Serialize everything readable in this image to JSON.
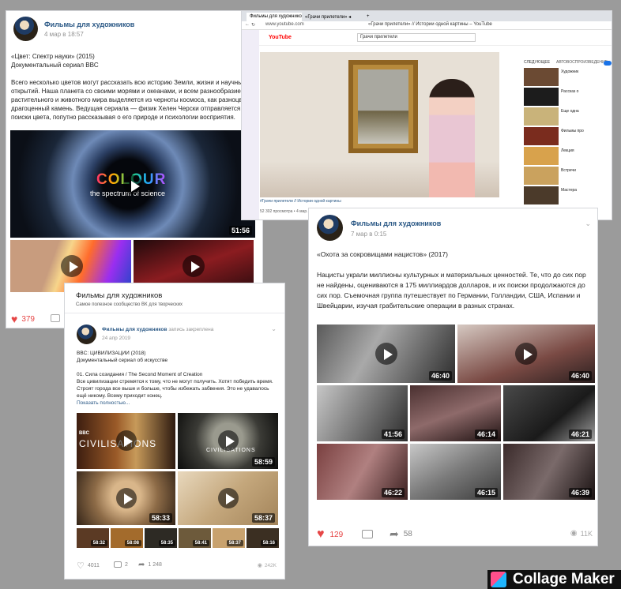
{
  "post1": {
    "group": "Фильмы для художников",
    "date": "4 мар в 18:57",
    "title_line1": "«Цвет: Спектр науки» (2015)",
    "title_line2": "Документальный сериал BBC",
    "body": "Всего несколько цветов могут рассказать всю историю Земли, жизни и научных открытий. Наша планета со своими морями и океанами, и всем разнообразием растительного и животного мира выделяется из черноты космоса, как разноцветный драгоценный камень. Ведущая сериала — физик Хелен Черски отправляется на поиски цвета, попутно рассказывая о его природе и психологии восприятия.",
    "video_title_main": "COLOUR",
    "video_title_sub": "the spectrum of science",
    "video_duration": "51:56",
    "likes": "379"
  },
  "browser": {
    "tab1": "Фильмы для художников",
    "tab2": "«Грачи прилетели» ◂",
    "tab3": "+",
    "url": "www.youtube.com",
    "page_title": "«Грачи прилетели» // Истории одной картины – YouTube",
    "yt_logo": "YouTube",
    "search_text": "Грачи прилетели",
    "sidebar_label": "СЛЕДУЮЩЕЕ",
    "autoplay_label": "АВТОВОСПРОИЗВЕДЕНИЕ",
    "video_caption": "#Грачи прилетели // Истории одной картины",
    "views": "52 302 просмотра • 4 мар. 2019 г.",
    "side_titles": [
      "Художник",
      "Рассказ о",
      "Еще одна",
      "Фильмы про",
      "Лекция",
      "Встречи",
      "Мастера"
    ]
  },
  "post2": {
    "group": "Фильмы для художников",
    "date": "7 мар в 0:15",
    "title": "«Охота за сокровищами нацистов» (2017)",
    "body": "Нацисты украли миллионы культурных и материальных ценностей. Те, что до сих пор не найдены, оцениваются в 175 миллиардов долларов, и их поиски продолжаются до сих пор. Съемочная группа путешествует по Германии, Голландии, США, Испании и Швейцарии, изучая грабительские операции в разных странах.",
    "durations": [
      "46:40",
      "46:40",
      "41:56",
      "46:14",
      "46:21",
      "46:22",
      "46:15",
      "46:39"
    ],
    "likes": "129",
    "shares": "58",
    "views": "11K"
  },
  "post3": {
    "header_title": "Фильмы для художников",
    "header_sub": "Самое полезное сообщество ВК для творческих",
    "group": "Фильмы для художников",
    "pinned": "запись закреплена",
    "date": "24 апр 2019",
    "title": "BBC: ЦИВИЛИЗАЦИИ (2018)",
    "subtitle": "Документальный сериал об искусстве",
    "episode": "01. Cила созидания / The Second Moment of Creation",
    "body": "Все цивилизации стремятся к тому, что не могут получить. Хотят победить время. Строят города все выше и больше, чтобы избежать забвения. Это не удавалось ещё никому. Всему приходит конец.",
    "more": "Показать полностью...",
    "bbc": "BBC",
    "civ_title": "CIVILISATIONS",
    "civ_title2": "CIVILISATIONS",
    "durations": [
      "58:59",
      "58:33",
      "58:37"
    ],
    "small_durations": [
      "58:32",
      "58:08",
      "58:35",
      "58:41",
      "58:37",
      "58:16"
    ],
    "likes": "4011",
    "comments": "2",
    "shares": "1 248",
    "views": "242K"
  },
  "watermark": "Collage Maker",
  "colors": {
    "vk_blue": "#2a5885",
    "like_red": "#e64646",
    "yt_red": "#ff0000"
  }
}
